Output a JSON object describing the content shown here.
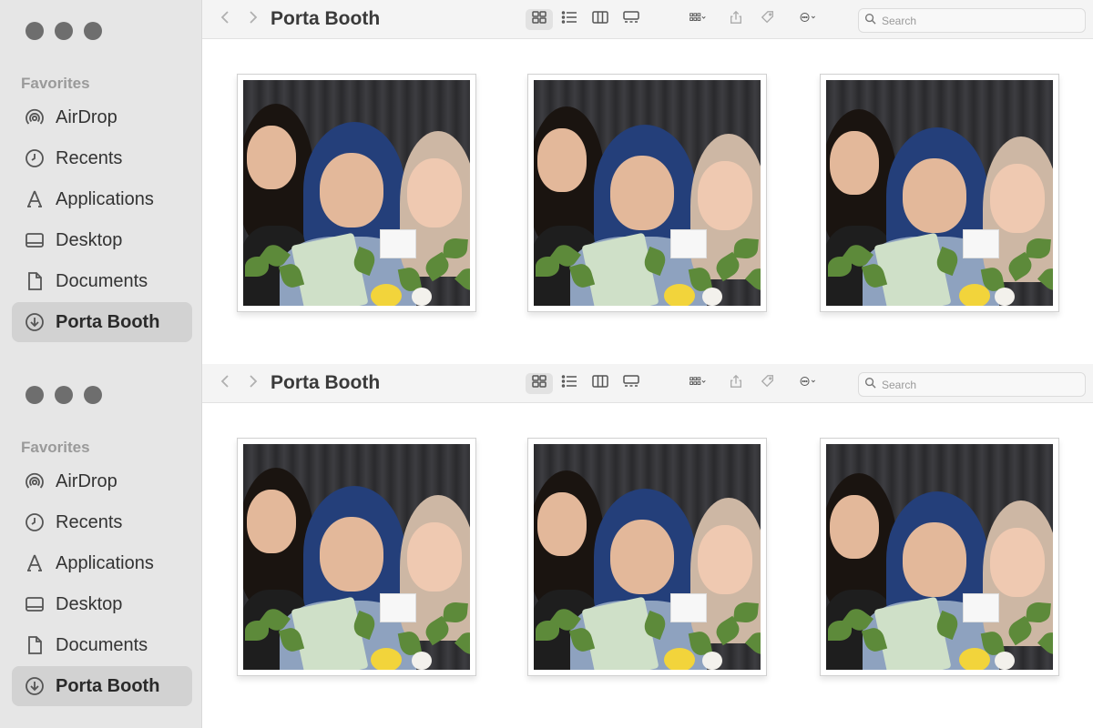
{
  "windows": [
    {
      "id": "w1",
      "sidebar": {
        "favorites_header": "Favorites",
        "items": [
          {
            "label": "AirDrop",
            "icon": "airdrop-icon",
            "selected": false
          },
          {
            "label": "Recents",
            "icon": "clock-icon",
            "selected": false
          },
          {
            "label": "Applications",
            "icon": "applications-icon",
            "selected": false
          },
          {
            "label": "Desktop",
            "icon": "desktop-icon",
            "selected": false
          },
          {
            "label": "Documents",
            "icon": "document-icon",
            "selected": false
          },
          {
            "label": "Porta Booth",
            "icon": "download-icon",
            "selected": true
          }
        ]
      },
      "toolbar": {
        "title": "Porta Booth",
        "search_placeholder": "Search"
      },
      "photos": [
        "photo-1",
        "photo-2",
        "photo-3"
      ]
    },
    {
      "id": "w2",
      "sidebar": {
        "favorites_header": "Favorites",
        "items": [
          {
            "label": "AirDrop",
            "icon": "airdrop-icon",
            "selected": false
          },
          {
            "label": "Recents",
            "icon": "clock-icon",
            "selected": false
          },
          {
            "label": "Applications",
            "icon": "applications-icon",
            "selected": false
          },
          {
            "label": "Desktop",
            "icon": "desktop-icon",
            "selected": false
          },
          {
            "label": "Documents",
            "icon": "document-icon",
            "selected": false
          },
          {
            "label": "Porta Booth",
            "icon": "download-icon",
            "selected": true
          }
        ]
      },
      "toolbar": {
        "title": "Porta Booth",
        "search_placeholder": "Search"
      },
      "photos": [
        "photo-4",
        "photo-5",
        "photo-6"
      ]
    }
  ],
  "colors": {
    "sidebar_bg": "#e6e6e6",
    "selected_bg": "#d2d2d2",
    "traffic_dot": "#6e6e6e",
    "hijab_blue": "#243f7a",
    "hijab_beige": "#cdb7a4"
  }
}
